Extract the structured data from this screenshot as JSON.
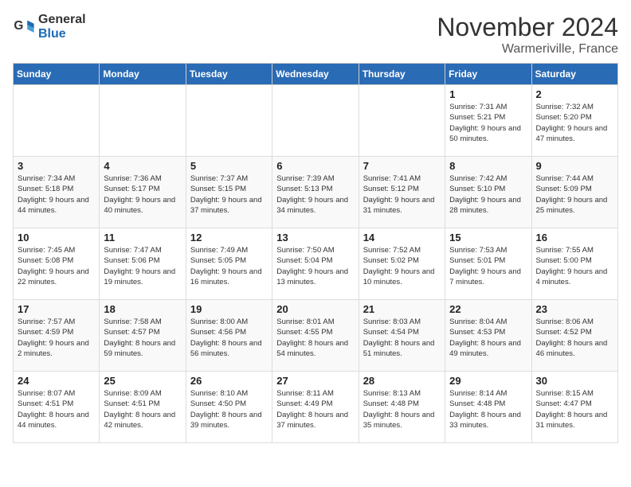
{
  "logo": {
    "general": "General",
    "blue": "Blue"
  },
  "header": {
    "month": "November 2024",
    "location": "Warmeriville, France"
  },
  "weekdays": [
    "Sunday",
    "Monday",
    "Tuesday",
    "Wednesday",
    "Thursday",
    "Friday",
    "Saturday"
  ],
  "weeks": [
    [
      {
        "day": "",
        "info": ""
      },
      {
        "day": "",
        "info": ""
      },
      {
        "day": "",
        "info": ""
      },
      {
        "day": "",
        "info": ""
      },
      {
        "day": "",
        "info": ""
      },
      {
        "day": "1",
        "info": "Sunrise: 7:31 AM\nSunset: 5:21 PM\nDaylight: 9 hours and 50 minutes."
      },
      {
        "day": "2",
        "info": "Sunrise: 7:32 AM\nSunset: 5:20 PM\nDaylight: 9 hours and 47 minutes."
      }
    ],
    [
      {
        "day": "3",
        "info": "Sunrise: 7:34 AM\nSunset: 5:18 PM\nDaylight: 9 hours and 44 minutes."
      },
      {
        "day": "4",
        "info": "Sunrise: 7:36 AM\nSunset: 5:17 PM\nDaylight: 9 hours and 40 minutes."
      },
      {
        "day": "5",
        "info": "Sunrise: 7:37 AM\nSunset: 5:15 PM\nDaylight: 9 hours and 37 minutes."
      },
      {
        "day": "6",
        "info": "Sunrise: 7:39 AM\nSunset: 5:13 PM\nDaylight: 9 hours and 34 minutes."
      },
      {
        "day": "7",
        "info": "Sunrise: 7:41 AM\nSunset: 5:12 PM\nDaylight: 9 hours and 31 minutes."
      },
      {
        "day": "8",
        "info": "Sunrise: 7:42 AM\nSunset: 5:10 PM\nDaylight: 9 hours and 28 minutes."
      },
      {
        "day": "9",
        "info": "Sunrise: 7:44 AM\nSunset: 5:09 PM\nDaylight: 9 hours and 25 minutes."
      }
    ],
    [
      {
        "day": "10",
        "info": "Sunrise: 7:45 AM\nSunset: 5:08 PM\nDaylight: 9 hours and 22 minutes."
      },
      {
        "day": "11",
        "info": "Sunrise: 7:47 AM\nSunset: 5:06 PM\nDaylight: 9 hours and 19 minutes."
      },
      {
        "day": "12",
        "info": "Sunrise: 7:49 AM\nSunset: 5:05 PM\nDaylight: 9 hours and 16 minutes."
      },
      {
        "day": "13",
        "info": "Sunrise: 7:50 AM\nSunset: 5:04 PM\nDaylight: 9 hours and 13 minutes."
      },
      {
        "day": "14",
        "info": "Sunrise: 7:52 AM\nSunset: 5:02 PM\nDaylight: 9 hours and 10 minutes."
      },
      {
        "day": "15",
        "info": "Sunrise: 7:53 AM\nSunset: 5:01 PM\nDaylight: 9 hours and 7 minutes."
      },
      {
        "day": "16",
        "info": "Sunrise: 7:55 AM\nSunset: 5:00 PM\nDaylight: 9 hours and 4 minutes."
      }
    ],
    [
      {
        "day": "17",
        "info": "Sunrise: 7:57 AM\nSunset: 4:59 PM\nDaylight: 9 hours and 2 minutes."
      },
      {
        "day": "18",
        "info": "Sunrise: 7:58 AM\nSunset: 4:57 PM\nDaylight: 8 hours and 59 minutes."
      },
      {
        "day": "19",
        "info": "Sunrise: 8:00 AM\nSunset: 4:56 PM\nDaylight: 8 hours and 56 minutes."
      },
      {
        "day": "20",
        "info": "Sunrise: 8:01 AM\nSunset: 4:55 PM\nDaylight: 8 hours and 54 minutes."
      },
      {
        "day": "21",
        "info": "Sunrise: 8:03 AM\nSunset: 4:54 PM\nDaylight: 8 hours and 51 minutes."
      },
      {
        "day": "22",
        "info": "Sunrise: 8:04 AM\nSunset: 4:53 PM\nDaylight: 8 hours and 49 minutes."
      },
      {
        "day": "23",
        "info": "Sunrise: 8:06 AM\nSunset: 4:52 PM\nDaylight: 8 hours and 46 minutes."
      }
    ],
    [
      {
        "day": "24",
        "info": "Sunrise: 8:07 AM\nSunset: 4:51 PM\nDaylight: 8 hours and 44 minutes."
      },
      {
        "day": "25",
        "info": "Sunrise: 8:09 AM\nSunset: 4:51 PM\nDaylight: 8 hours and 42 minutes."
      },
      {
        "day": "26",
        "info": "Sunrise: 8:10 AM\nSunset: 4:50 PM\nDaylight: 8 hours and 39 minutes."
      },
      {
        "day": "27",
        "info": "Sunrise: 8:11 AM\nSunset: 4:49 PM\nDaylight: 8 hours and 37 minutes."
      },
      {
        "day": "28",
        "info": "Sunrise: 8:13 AM\nSunset: 4:48 PM\nDaylight: 8 hours and 35 minutes."
      },
      {
        "day": "29",
        "info": "Sunrise: 8:14 AM\nSunset: 4:48 PM\nDaylight: 8 hours and 33 minutes."
      },
      {
        "day": "30",
        "info": "Sunrise: 8:15 AM\nSunset: 4:47 PM\nDaylight: 8 hours and 31 minutes."
      }
    ]
  ]
}
